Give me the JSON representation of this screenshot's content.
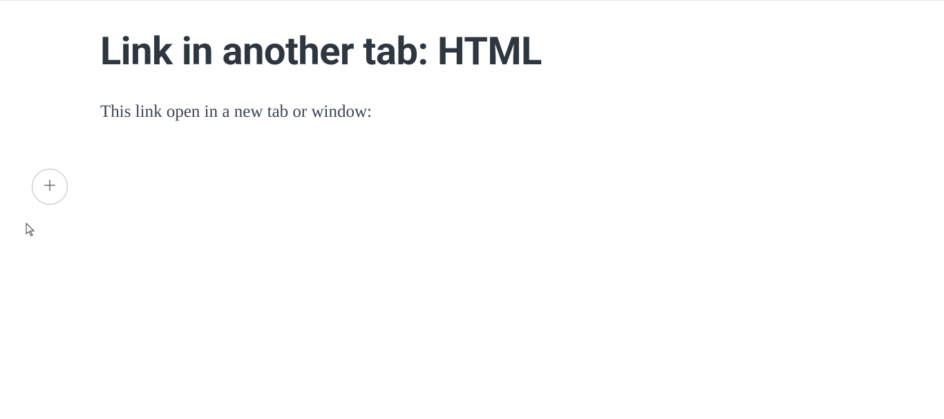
{
  "content": {
    "title": "Link in another tab: HTML",
    "description": "This link open in a new tab or window:"
  }
}
